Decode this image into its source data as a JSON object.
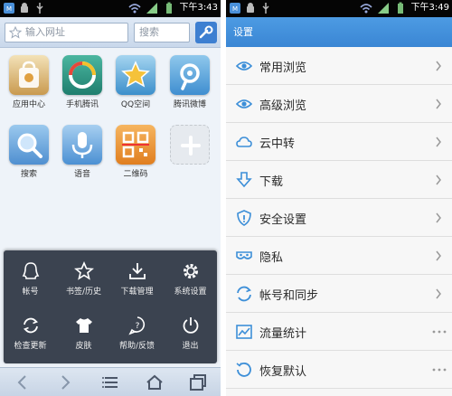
{
  "left_phone": {
    "status_time": "下午3:43",
    "url_placeholder": "输入网址",
    "search_placeholder": "搜索",
    "apps": [
      {
        "label": "应用中心",
        "icon": "app-center-icon",
        "color": "#c99a4f"
      },
      {
        "label": "手机腾讯",
        "icon": "tencent-icon",
        "color": "#2c9d8a"
      },
      {
        "label": "QQ空间",
        "icon": "qzone-icon",
        "color": "#5aa6d6"
      },
      {
        "label": "腾讯微博",
        "icon": "weibo-icon",
        "color": "#4e9fd3"
      },
      {
        "label": "搜索",
        "icon": "search-icon",
        "color": "#5b9ad6"
      },
      {
        "label": "语音",
        "icon": "microphone-icon",
        "color": "#5d9ed8"
      },
      {
        "label": "二维码",
        "icon": "qrcode-icon",
        "color": "#e99332"
      },
      {
        "label": "",
        "icon": "add-icon",
        "color": "#dcdcdc"
      }
    ],
    "menu": [
      {
        "label": "帐号",
        "icon": "account-icon"
      },
      {
        "label": "书签/历史",
        "icon": "bookmark-star-icon"
      },
      {
        "label": "下载管理",
        "icon": "download-icon"
      },
      {
        "label": "系统设置",
        "icon": "gear-icon"
      },
      {
        "label": "检查更新",
        "icon": "refresh-icon"
      },
      {
        "label": "皮肤",
        "icon": "skin-shirt-icon"
      },
      {
        "label": "帮助/反馈",
        "icon": "help-icon"
      },
      {
        "label": "退出",
        "icon": "power-icon"
      }
    ]
  },
  "right_phone": {
    "status_time": "下午3:49",
    "title": "设置",
    "items": [
      {
        "label": "常用浏览",
        "icon": "eye-icon"
      },
      {
        "label": "高级浏览",
        "icon": "eye-icon"
      },
      {
        "label": "云中转",
        "icon": "cloud-icon"
      },
      {
        "label": "下载",
        "icon": "download-arrow-icon"
      },
      {
        "label": "安全设置",
        "icon": "shield-icon"
      },
      {
        "label": "隐私",
        "icon": "mask-icon"
      },
      {
        "label": "帐号和同步",
        "icon": "sync-icon"
      },
      {
        "label": "流量统计",
        "icon": "chart-icon"
      },
      {
        "label": "恢复默认",
        "icon": "restore-icon"
      }
    ]
  },
  "colors": {
    "accent": "#3a86d4",
    "menu_bg": "#3b4350"
  }
}
